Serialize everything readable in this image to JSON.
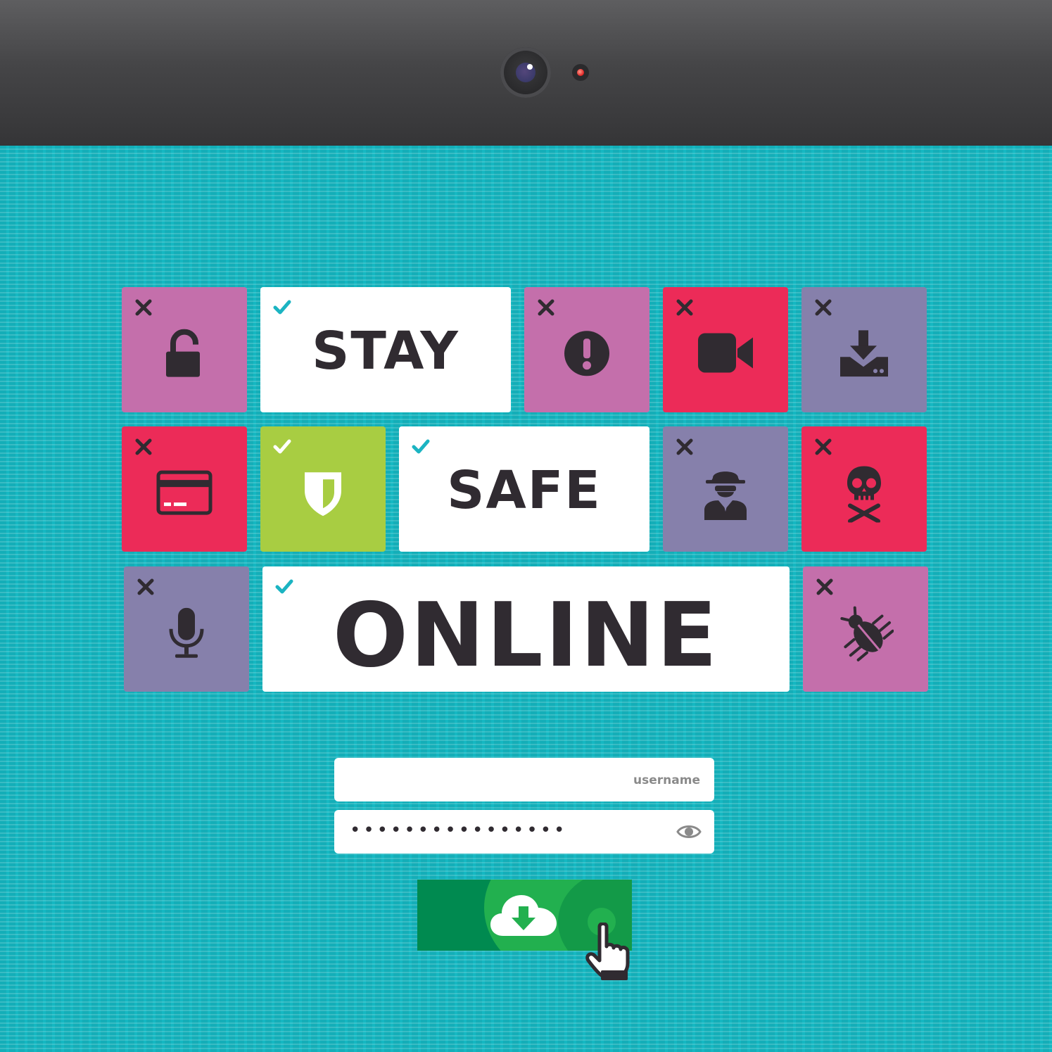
{
  "colors": {
    "teal_background": "#15b8c2",
    "pink": "#c46fab",
    "red": "#ec2b58",
    "lavender": "#8680ab",
    "lime": "#a8cd42",
    "dark_text": "#302b31",
    "check_teal": "#1bb4c2",
    "button_green": "#008a50",
    "button_light_green": "#22b04f"
  },
  "tiles": {
    "unlock": {
      "icon": "unlocked-padlock-icon",
      "status": "cross-mark-icon"
    },
    "alert": {
      "icon": "exclamation-icon",
      "status": "cross-mark-icon"
    },
    "camera": {
      "icon": "video-camera-icon",
      "status": "cross-mark-icon"
    },
    "download": {
      "icon": "download-tray-icon",
      "status": "cross-mark-icon"
    },
    "card": {
      "icon": "credit-card-icon",
      "status": "cross-mark-icon"
    },
    "shield": {
      "icon": "shield-icon",
      "status": "check-mark-icon"
    },
    "spy": {
      "icon": "spy-icon",
      "status": "cross-mark-icon"
    },
    "skull": {
      "icon": "skull-crossbones-icon",
      "status": "cross-mark-icon"
    },
    "mic": {
      "icon": "microphone-icon",
      "status": "cross-mark-icon"
    },
    "bug": {
      "icon": "bug-icon",
      "status": "cross-mark-icon"
    }
  },
  "words": {
    "stay": "STAY",
    "safe": "SAFE",
    "online": "ONLINE"
  },
  "login": {
    "username_placeholder": "username",
    "password_mask": "••••••••••••••••"
  },
  "download_button": {
    "icon": "cloud-download-icon",
    "cursor": "hand-pointer-icon"
  }
}
